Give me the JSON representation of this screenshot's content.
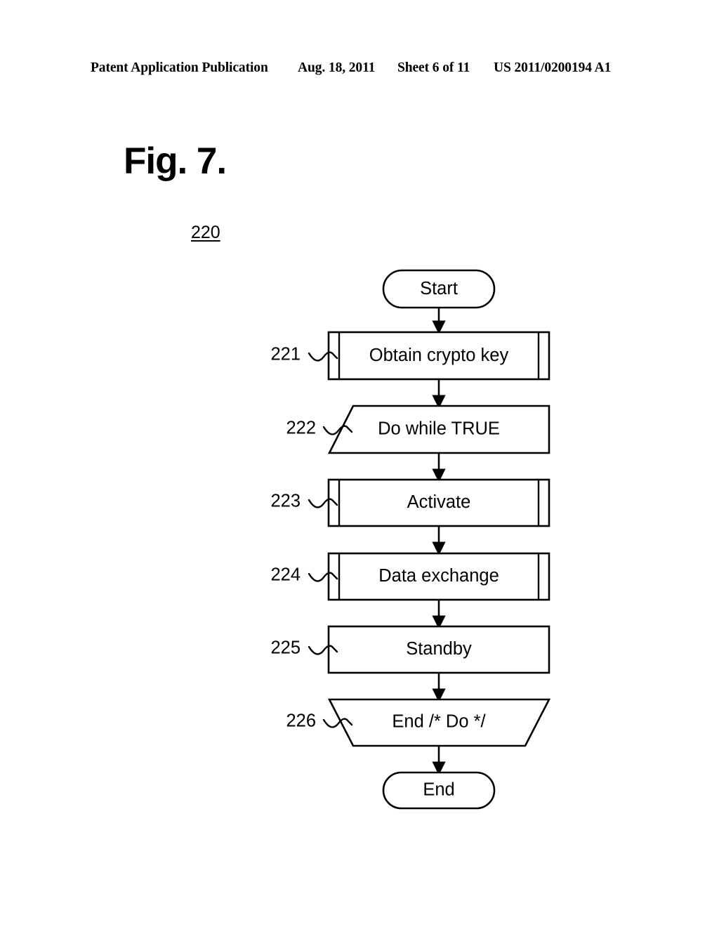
{
  "header": {
    "publication": "Patent Application Publication",
    "date": "Aug. 18, 2011",
    "sheet": "Sheet 6 of 11",
    "patent_number": "US 2011/0200194 A1"
  },
  "figure": {
    "title": "Fig. 7.",
    "reference_numeral": "220"
  },
  "flowchart": {
    "nodes": [
      {
        "id": "start",
        "label": "Start",
        "shape": "terminator",
        "ref": ""
      },
      {
        "id": "n221",
        "label": "Obtain crypto key",
        "shape": "predefined-process",
        "ref": "221"
      },
      {
        "id": "n222",
        "label": "Do while TRUE",
        "shape": "loop-start",
        "ref": "222"
      },
      {
        "id": "n223",
        "label": "Activate",
        "shape": "predefined-process",
        "ref": "223"
      },
      {
        "id": "n224",
        "label": "Data exchange",
        "shape": "predefined-process",
        "ref": "224"
      },
      {
        "id": "n225",
        "label": "Standby",
        "shape": "process",
        "ref": "225"
      },
      {
        "id": "n226",
        "label": "End /* Do */",
        "shape": "loop-end",
        "ref": "226"
      },
      {
        "id": "end",
        "label": "End",
        "shape": "terminator",
        "ref": ""
      }
    ],
    "colors": {
      "stroke": "#000000",
      "fill": "#ffffff"
    }
  }
}
